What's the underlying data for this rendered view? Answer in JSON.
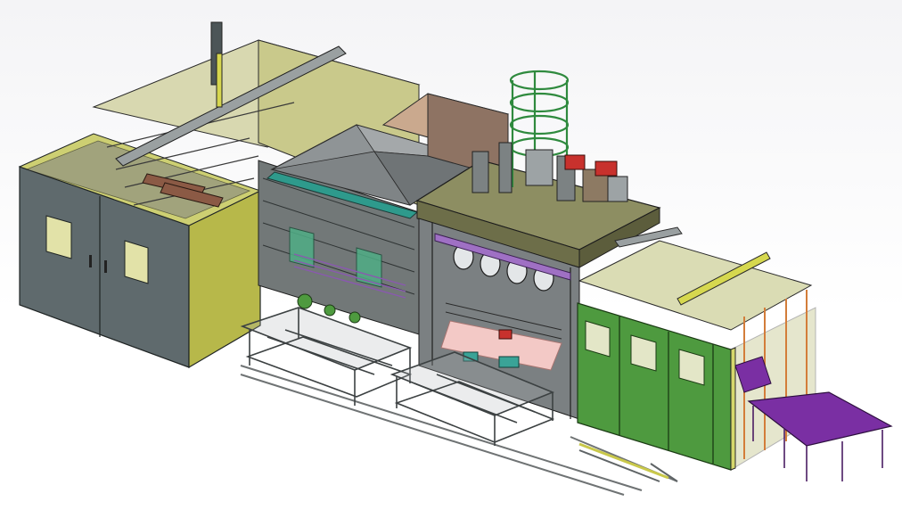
{
  "scene": {
    "subject": "",
    "palette": {
      "left_enclosure_panel": "#5f6a6d",
      "left_enclosure_frame": "#b7b84a",
      "frame_steel": "#6d7474",
      "center_roof": "#8f9496",
      "green_doors": "#4e9a3f",
      "red_accent": "#c8312d",
      "purple_table": "#7a2fa3",
      "pink_glow": "#f3c9c6",
      "teal_glass": "#4fae86",
      "orange_frame": "#d37d3a",
      "ground_track": "#7b7f80"
    }
  }
}
